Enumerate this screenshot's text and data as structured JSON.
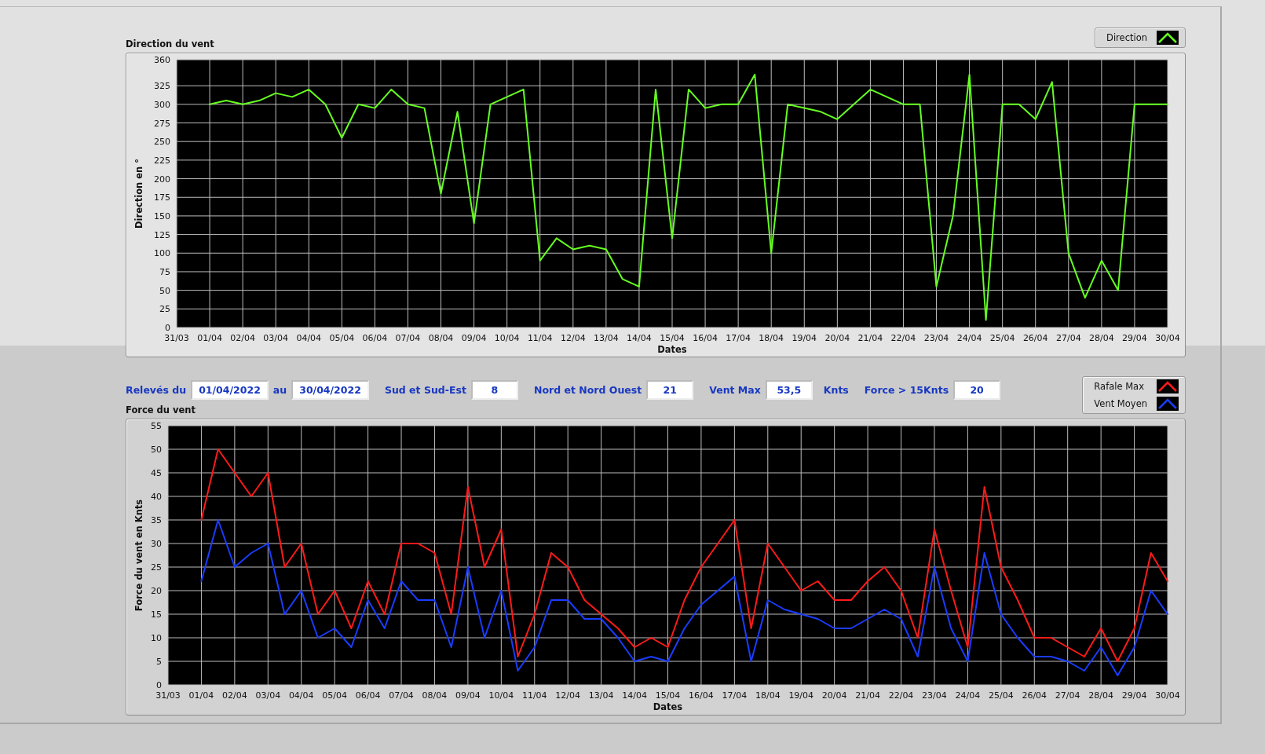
{
  "direction_chart": {
    "title": "Direction du vent",
    "chart_data": {
      "type": "line",
      "grid": true,
      "xlabel": "Dates",
      "ylabel": "Direction en °",
      "ylim": [
        0,
        360
      ],
      "categories": [
        "31/03",
        null,
        "01/04",
        null,
        "02/04",
        null,
        "03/04",
        null,
        "04/04",
        null,
        "05/04",
        null,
        "06/04",
        null,
        "07/04",
        null,
        "08/04",
        null,
        "09/04",
        null,
        "10/04",
        null,
        "11/04",
        null,
        "12/04",
        null,
        "13/04",
        null,
        "14/04",
        null,
        "15/04",
        null,
        "16/04",
        null,
        "17/04",
        null,
        "18/04",
        null,
        "19/04",
        null,
        "20/04",
        null,
        "21/04",
        null,
        "22/04",
        null,
        "23/04",
        null,
        "24/04",
        null,
        "25/04",
        null,
        "26/04",
        null,
        "27/04",
        null,
        "28/04",
        null,
        "29/04",
        null,
        "30/04"
      ],
      "series": [
        {
          "name": "Direction",
          "color": "#66ff22",
          "values": [
            null,
            null,
            300,
            305,
            300,
            305,
            315,
            310,
            320,
            300,
            255,
            300,
            295,
            320,
            300,
            295,
            180,
            290,
            140,
            300,
            310,
            320,
            90,
            120,
            105,
            110,
            105,
            65,
            55,
            320,
            120,
            320,
            295,
            300,
            300,
            340,
            100,
            300,
            295,
            290,
            280,
            300,
            320,
            310,
            300,
            300,
            55,
            150,
            340,
            10,
            300,
            300,
            280,
            330,
            100,
            40,
            90,
            50,
            300,
            300,
            300
          ]
        }
      ],
      "yticks": [
        0,
        25,
        50,
        75,
        100,
        125,
        150,
        175,
        200,
        225,
        250,
        275,
        300,
        325,
        360
      ]
    }
  },
  "summary_fields": [
    {
      "label": "Relevés du",
      "value": "01/04/2022"
    },
    {
      "label": "au",
      "value": "30/04/2022"
    },
    {
      "label": "Sud et Sud-Est",
      "value": "8"
    },
    {
      "label": "Nord et Nord Ouest",
      "value": "21"
    },
    {
      "label": "Vent Max",
      "value": "53,5",
      "unit": "Knts"
    },
    {
      "label": "Force > 15Knts",
      "value": "20"
    }
  ],
  "force_chart": {
    "title": "Force du vent",
    "chart_data": {
      "type": "line",
      "grid": true,
      "xlabel": "Dates",
      "ylabel": "Force du vent en Knts",
      "ylim": [
        0,
        55
      ],
      "categories": [
        "31/03",
        null,
        "01/04",
        null,
        "02/04",
        null,
        "03/04",
        null,
        "04/04",
        null,
        "05/04",
        null,
        "06/04",
        null,
        "07/04",
        null,
        "08/04",
        null,
        "09/04",
        null,
        "10/04",
        null,
        "11/04",
        null,
        "12/04",
        null,
        "13/04",
        null,
        "14/04",
        null,
        "15/04",
        null,
        "16/04",
        null,
        "17/04",
        null,
        "18/04",
        null,
        "19/04",
        null,
        "20/04",
        null,
        "21/04",
        null,
        "22/04",
        null,
        "23/04",
        null,
        "24/04",
        null,
        "25/04",
        null,
        "26/04",
        null,
        "27/04",
        null,
        "28/04",
        null,
        "29/04",
        null,
        "30/04"
      ],
      "series": [
        {
          "name": "Rafale Max",
          "color": "#ff1a1a",
          "values": [
            null,
            null,
            35,
            50,
            45,
            40,
            45,
            25,
            30,
            15,
            20,
            12,
            22,
            15,
            30,
            30,
            28,
            15,
            42,
            25,
            33,
            6,
            15,
            28,
            25,
            18,
            15,
            12,
            8,
            10,
            8,
            18,
            25,
            30,
            35,
            12,
            30,
            25,
            20,
            22,
            18,
            18,
            22,
            25,
            20,
            10,
            33,
            20,
            8,
            42,
            25,
            18,
            10,
            10,
            8,
            6,
            12,
            5,
            12,
            28,
            22
          ]
        },
        {
          "name": "Vent Moyen",
          "color": "#1a3cff",
          "values": [
            null,
            null,
            22,
            35,
            25,
            28,
            30,
            15,
            20,
            10,
            12,
            8,
            18,
            12,
            22,
            18,
            18,
            8,
            25,
            10,
            20,
            3,
            8,
            18,
            18,
            14,
            14,
            10,
            5,
            6,
            5,
            12,
            17,
            20,
            23,
            5,
            18,
            16,
            15,
            14,
            12,
            12,
            14,
            16,
            14,
            6,
            25,
            12,
            5,
            28,
            15,
            10,
            6,
            6,
            5,
            3,
            8,
            2,
            8,
            20,
            15
          ]
        }
      ],
      "yticks": [
        0,
        5,
        10,
        15,
        20,
        25,
        30,
        35,
        40,
        45,
        50,
        55
      ]
    }
  }
}
